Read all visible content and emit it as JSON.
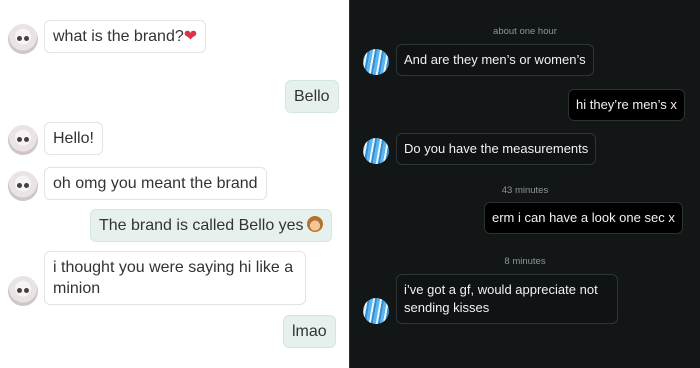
{
  "left_chat": {
    "messages": [
      {
        "from": "them",
        "text": "what is the brand?",
        "emoji": "❤"
      },
      {
        "from": "me",
        "text": "Bello"
      },
      {
        "from": "them",
        "text": "Hello!"
      },
      {
        "from": "them",
        "text": "oh omg you meant the brand"
      },
      {
        "from": "me",
        "text": "The brand is called Bello yes",
        "emoji": "see-no-evil-monkey"
      },
      {
        "from": "them",
        "text": "i thought you were saying hi like a minion"
      },
      {
        "from": "me",
        "text": "lmao"
      }
    ]
  },
  "right_chat": {
    "timestamps": [
      "about one hour",
      "43 minutes",
      "8 minutes"
    ],
    "messages": [
      {
        "from": "them",
        "text": "And are they men’s or women’s"
      },
      {
        "from": "me",
        "text": "hi they’re men’s x"
      },
      {
        "from": "them",
        "text": "Do you have the measurements"
      },
      {
        "from": "me",
        "text": "erm i can have a look one sec x"
      },
      {
        "from": "them",
        "text": "i’ve got a gf, would appreciate not sending kisses"
      }
    ]
  }
}
